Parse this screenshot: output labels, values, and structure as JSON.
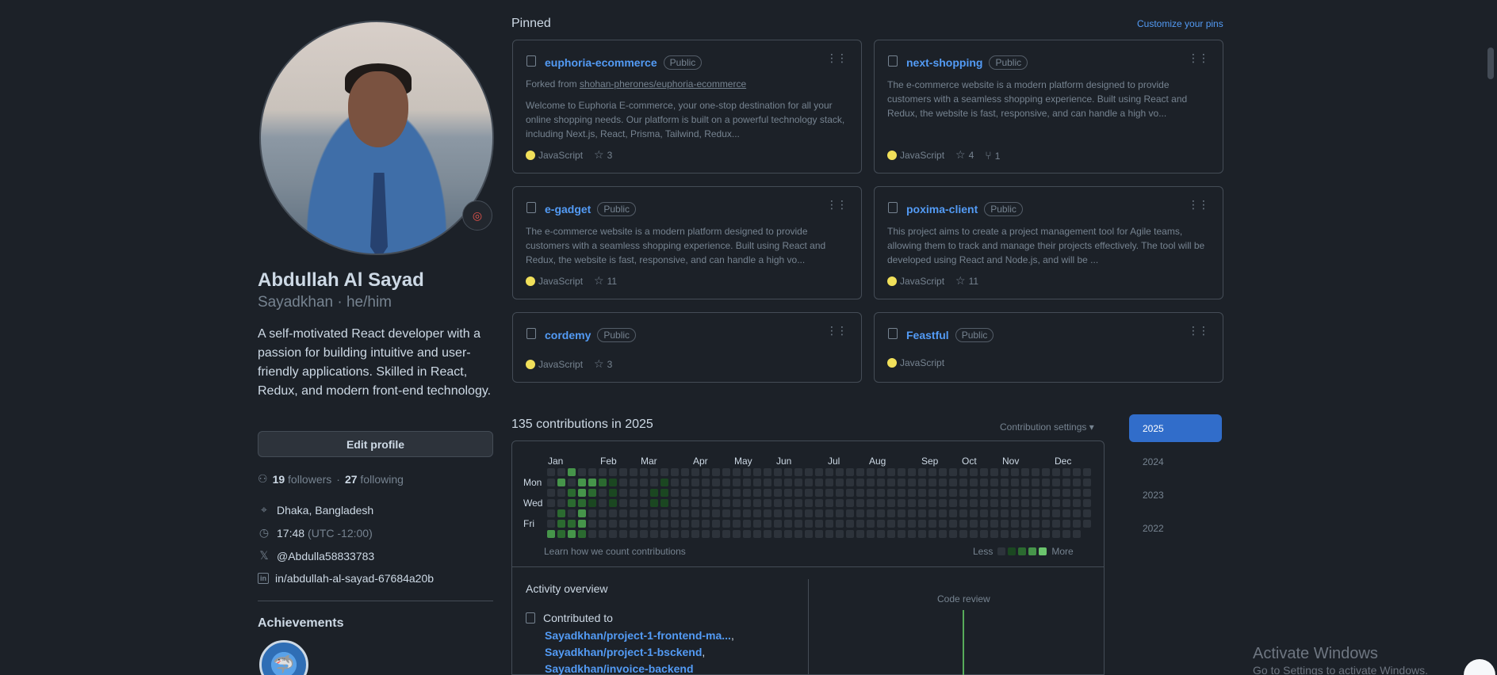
{
  "profile": {
    "name": "Abdullah Al Sayad",
    "handle": "Sayadkhan · he/him",
    "bio": "A self-motivated React developer with a passion for building intuitive and user-friendly applications. Skilled in React, Redux, and modern front-end technology.",
    "edit_label": "Edit profile",
    "followers_count": "19",
    "followers_label": "followers",
    "sep": "·",
    "following_count": "27",
    "following_label": "following",
    "location": "Dhaka, Bangladesh",
    "time": "17:48",
    "timezone": "(UTC -12:00)",
    "twitter": "@Abdulla58833783",
    "linkedin": "in/abdullah-al-sayad-67684a20b",
    "achievements_title": "Achievements"
  },
  "pinned": {
    "title": "Pinned",
    "customize_label": "Customize your pins",
    "visibility": "Public",
    "cards": [
      {
        "name": "euphoria-ecommerce",
        "fork_prefix": "Forked from",
        "fork_from": "shohan-pherones/euphoria-ecommerce",
        "desc": "Welcome to Euphoria E-commerce, your one-stop destination for all your online shopping needs. Our platform is built on a powerful technology stack, including Next.js, React, Prisma, Tailwind, Redux...",
        "lang": "JavaScript",
        "stars": "3"
      },
      {
        "name": "next-shopping",
        "desc": "The e-commerce website is a modern platform designed to provide customers with a seamless shopping experience. Built using React and Redux, the website is fast, responsive, and can handle a high vo...",
        "lang": "JavaScript",
        "stars": "4",
        "forks": "1"
      },
      {
        "name": "e-gadget",
        "desc": "The e-commerce website is a modern platform designed to provide customers with a seamless shopping experience. Built using React and Redux, the website is fast, responsive, and can handle a high vo...",
        "lang": "JavaScript",
        "stars": "11"
      },
      {
        "name": "poxima-client",
        "desc": "This project aims to create a project management tool for Agile teams, allowing them to track and manage their projects effectively. The tool will be developed using React and Node.js, and will be ...",
        "lang": "JavaScript",
        "stars": "11"
      },
      {
        "name": "cordemy",
        "lang": "JavaScript",
        "stars": "3"
      },
      {
        "name": "Feastful",
        "lang": "JavaScript"
      }
    ]
  },
  "contributions": {
    "title": "135 contributions in 2025",
    "settings_label": "Contribution settings",
    "months": [
      "Jan",
      "Feb",
      "Mar",
      "Apr",
      "May",
      "Jun",
      "Jul",
      "Aug",
      "Sep",
      "Oct",
      "Nov",
      "Dec"
    ],
    "days": [
      "Mon",
      "Wed",
      "Fri"
    ],
    "learn_label": "Learn how we count contributions",
    "less_label": "Less",
    "more_label": "More",
    "colors": [
      "#2d333b",
      "#1b4721",
      "#2b6a30",
      "#46954a",
      "#6bc46d"
    ]
  },
  "activity": {
    "title": "Activity overview",
    "contributed_to": "Contributed to",
    "repos": [
      "Sayadkhan/project-1-frontend-ma...",
      "Sayadkhan/project-1-bsckend",
      "Sayadkhan/invoice-backend"
    ],
    "code_review": "Code review"
  },
  "years": [
    "2025",
    "2024",
    "2023",
    "2022"
  ],
  "watermark": {
    "title": "Activate Windows",
    "sub": "Go to Settings to activate Windows."
  }
}
